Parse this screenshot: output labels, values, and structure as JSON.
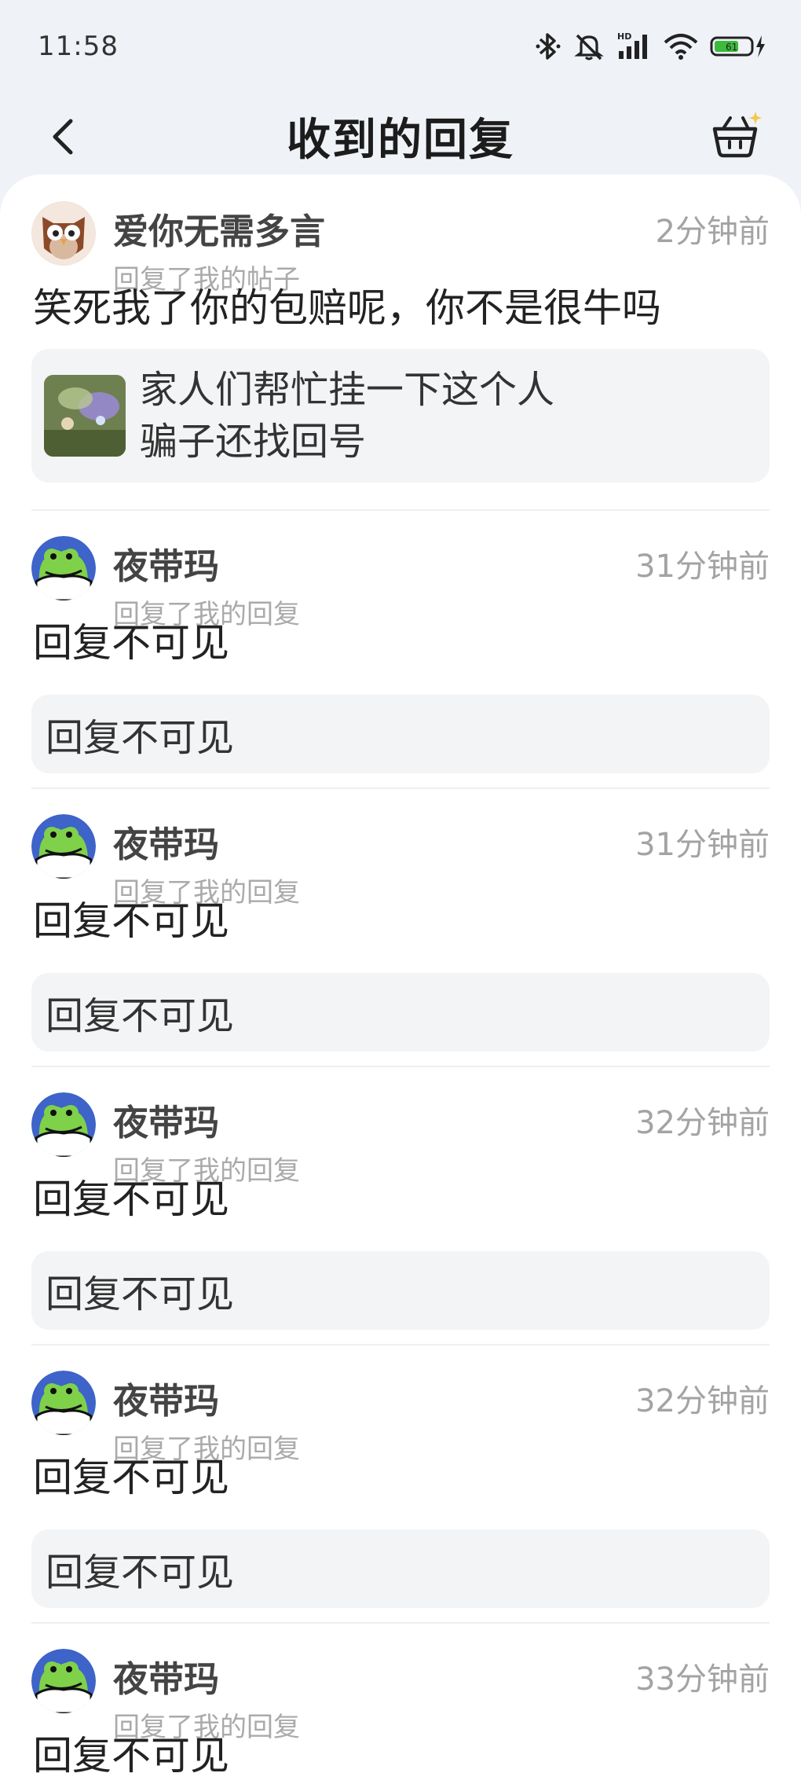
{
  "status": {
    "time": "11:58"
  },
  "header": {
    "title": "收到的回复"
  },
  "replies": [
    {
      "name": "爱你无需多言",
      "time": "2分钟前",
      "type": "回复了我的帖子",
      "content": "笑死我了你的包赔呢，你不是很牛吗",
      "quote_lines": [
        "家人们帮忙挂一下这个人",
        "骗子还找回号"
      ],
      "avatar": "owl-avatar"
    },
    {
      "name": "夜带玛",
      "time": "31分钟前",
      "type": "回复了我的回复",
      "content": "回复不可见",
      "quote": "回复不可见",
      "avatar": "frog-avatar"
    },
    {
      "name": "夜带玛",
      "time": "31分钟前",
      "type": "回复了我的回复",
      "content": "回复不可见",
      "quote": "回复不可见",
      "avatar": "frog-avatar"
    },
    {
      "name": "夜带玛",
      "time": "32分钟前",
      "type": "回复了我的回复",
      "content": "回复不可见",
      "quote": "回复不可见",
      "avatar": "frog-avatar"
    },
    {
      "name": "夜带玛",
      "time": "32分钟前",
      "type": "回复了我的回复",
      "content": "回复不可见",
      "quote": "回复不可见",
      "avatar": "frog-avatar"
    },
    {
      "name": "夜带玛",
      "time": "33分钟前",
      "type": "回复了我的回复",
      "content": "回复不可见",
      "avatar": "frog-avatar"
    }
  ]
}
